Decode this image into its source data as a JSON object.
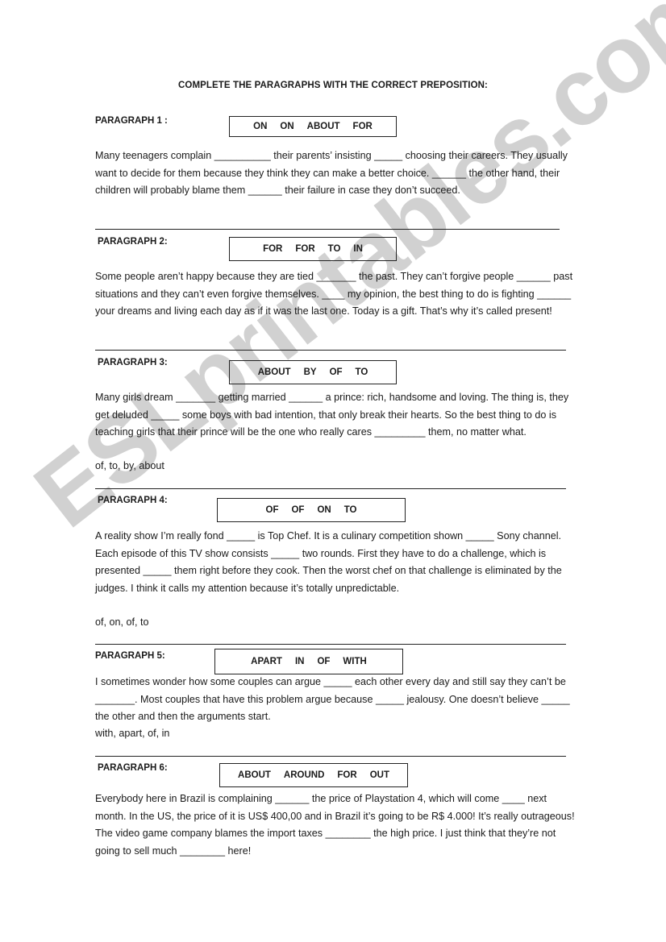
{
  "title": "COMPLETE THE PARAGRAPHS WITH THE CORRECT PREPOSITION:",
  "watermark": "ESLprintables.com",
  "paragraphs": [
    {
      "label": "PARAGRAPH 1 :",
      "words": [
        "ON",
        "ON",
        "ABOUT",
        "FOR"
      ],
      "text": "Many teenagers complain __________ their parents’ insisting _____ choosing their careers. They usually want to decide for them because they think they can make a better choice. ______ the other hand, their children will probably blame them ______ their failure in case they don’t succeed.",
      "answers": ""
    },
    {
      "label": "PARAGRAPH 2:",
      "words": [
        "FOR",
        "FOR",
        "TO",
        "IN"
      ],
      "text": "Some people aren’t happy because they are tied _______ the past. They can’t forgive people ______ past situations and they can’t even forgive themselves. ____ my opinion, the best thing to do is fighting ______ your dreams and living each day as if it was the last one. Today is a gift. That’s why it’s called present!",
      "answers": ""
    },
    {
      "label": "PARAGRAPH 3:",
      "words": [
        "ABOUT",
        "BY",
        "OF",
        "TO"
      ],
      "text": "Many girls dream _______ getting married ______ a prince: rich, handsome and loving. The thing is, they get deluded _____ some boys with bad intention, that only break their hearts. So the best thing to do is teaching girls that their prince will be the one who really cares _________ them, no matter what.",
      "answers": "of, to, by, about"
    },
    {
      "label": "PARAGRAPH 4:",
      "words": [
        "OF",
        "OF",
        "ON",
        "TO"
      ],
      "text": "A reality show I’m really fond _____ is Top Chef. It is a culinary competition shown _____ Sony channel. Each episode of this TV show consists _____ two rounds. First they have to do a challenge, which is presented _____ them right before they cook. Then the worst chef on that challenge is eliminated by the judges. I think it calls my attention because it’s totally unpredictable.",
      "answers": "of, on, of, to"
    },
    {
      "label": "PARAGRAPH 5:",
      "words": [
        "APART",
        "IN",
        "OF",
        "WITH"
      ],
      "text": "I sometimes wonder how some couples can argue _____ each other every day and still say they can’t be _______. Most couples that have this problem argue because _____ jealousy. One doesn’t believe _____ the other and then the arguments start.",
      "answers": "with, apart, of, in"
    },
    {
      "label": "PARAGRAPH 6:",
      "words": [
        "ABOUT",
        "AROUND",
        "FOR",
        "OUT"
      ],
      "text": "Everybody here in Brazil is complaining ______ the price of Playstation 4, which will come ____ next month. In the US, the price of it is US$ 400,00 and in Brazil it’s going to be R$ 4.000! It’s really outrageous! The video game company blames the import taxes ________ the high price. I just think that they’re not going to sell much ________ here!",
      "answers": ""
    }
  ]
}
